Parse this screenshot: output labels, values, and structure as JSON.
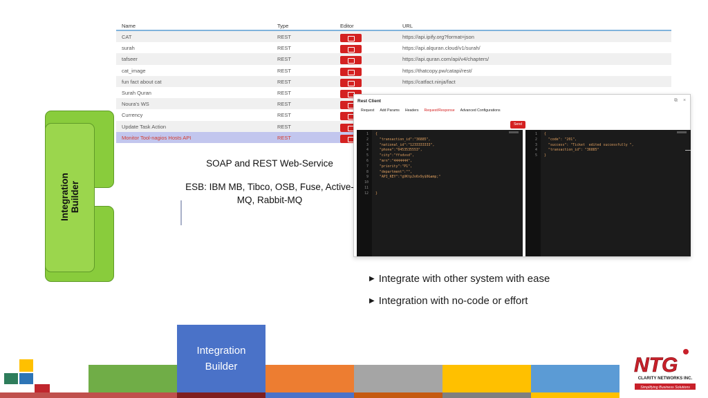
{
  "table": {
    "headers": {
      "name": "Name",
      "type": "Type",
      "editor": "Editor",
      "url": "URL"
    },
    "rows": [
      {
        "name": "CAT",
        "type": "REST",
        "url": "https://api.ipify.org?format=json"
      },
      {
        "name": "surah",
        "type": "REST",
        "url": "https://api.alquran.cloud/v1/surah/"
      },
      {
        "name": "tafseer",
        "type": "REST",
        "url": "https://api.quran.com/api/v4/chapters/"
      },
      {
        "name": "cat_image",
        "type": "REST",
        "url": "https://thatcopy.pw/catapi/rest/"
      },
      {
        "name": "fun fact about cat",
        "type": "REST",
        "url": "https://catfact.ninja/fact"
      },
      {
        "name": "Surah Quran",
        "type": "REST",
        "url": ""
      },
      {
        "name": "Noura's WS",
        "type": "REST",
        "url": ""
      },
      {
        "name": "Currency",
        "type": "REST",
        "url": ""
      },
      {
        "name": "Update Task Action",
        "type": "REST",
        "url": ""
      },
      {
        "name": "Monitor Tool-nagios Hosts API",
        "type": "REST",
        "url": "",
        "selected": true
      }
    ]
  },
  "side_title": "Integration\nBuilder",
  "center_text": {
    "line1": "SOAP and REST Web-Service",
    "line2": "ESB: IBM MB, Tibco, OSB, Fuse, Active-MQ,  Rabbit-MQ"
  },
  "rest_client": {
    "title": "Rest Client",
    "maximize_icon": "⧉",
    "close_icon": "×",
    "tabs": [
      "Request",
      "Add Params",
      "Headers",
      "Request/Response",
      "Advanced Configurations"
    ],
    "active_tab": "Request/Response",
    "send_label": "Send",
    "request_lines": [
      "{",
      "  \"transaction_id\":\"36885\",",
      "  \"national_id\":\"1233333333\",",
      "  \"phone\":\"0453535553\",",
      "  \"city\":\"ffsdvsd\",",
      "  \"mrn\":\"4444444\",",
      "  \"priority\":\"P1\",",
      "  \"department\":\"\",",
      "  \"API_KEY\":\"gVKtpJo6x9y$0&amp;\"",
      "",
      "",
      "}"
    ],
    "response_lines": [
      "{",
      "  \"code\": \"201\",",
      "  \"success\": \"Ticket  edited successfully \",",
      "  \"transaction_id\": \"36885\"",
      "}"
    ]
  },
  "bullets": [
    "Integrate with other system with ease",
    "Integration with no-code or effort"
  ],
  "bottom_bar": {
    "active_label": "Integration\nBuilder",
    "colors": [
      "#70ad47",
      "#4a72c8",
      "#ed7d31",
      "#a5a5a5",
      "#ffc000",
      "#5b9bd5"
    ]
  },
  "logo": {
    "brand": "NTG",
    "company": "CLARITY NETWORKS INC.",
    "tagline": "Simplifying Business Solutions"
  }
}
